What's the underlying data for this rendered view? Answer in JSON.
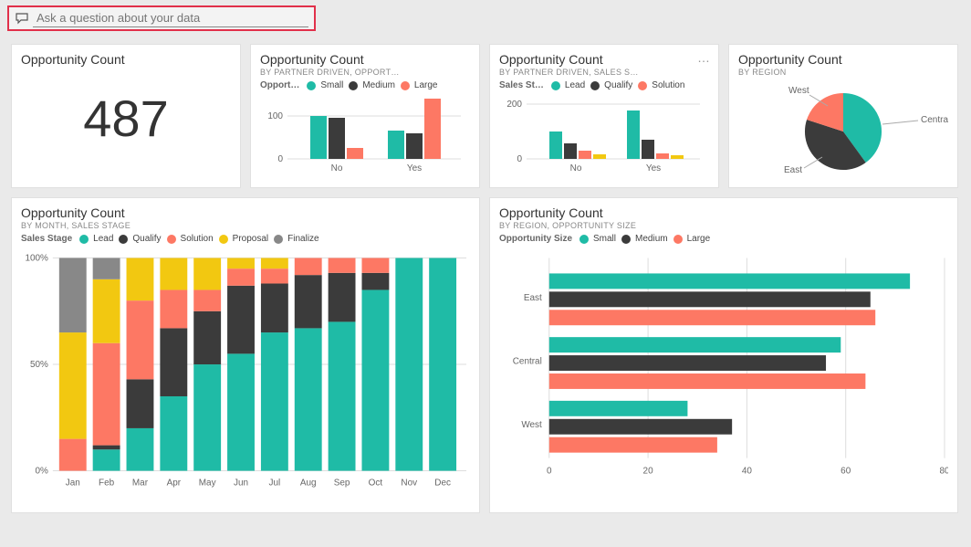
{
  "qna": {
    "placeholder": "Ask a question about your data"
  },
  "colors": {
    "teal": "#1fbba6",
    "dark": "#3b3b3b",
    "coral": "#fd7864",
    "yellow": "#f2c811",
    "gray": "#888888"
  },
  "card_kpi": {
    "title": "Opportunity Count",
    "value": "487"
  },
  "card_partner_size": {
    "title": "Opportunity Count",
    "subtitle": "BY PARTNER DRIVEN, OPPORT…",
    "legend_label": "Opport…",
    "legend": [
      "Small",
      "Medium",
      "Large"
    ]
  },
  "card_partner_stage": {
    "title": "Opportunity Count",
    "subtitle": "BY PARTNER DRIVEN, SALES S…",
    "legend_label": "Sales St…",
    "legend": [
      "Lead",
      "Qualify",
      "Solution"
    ]
  },
  "card_region_pie": {
    "title": "Opportunity Count",
    "subtitle": "BY REGION",
    "labels": {
      "west": "West",
      "east": "East",
      "central": "Central"
    }
  },
  "card_month_stage": {
    "title": "Opportunity Count",
    "subtitle": "BY MONTH, SALES STAGE",
    "legend_label": "Sales Stage",
    "legend": [
      "Lead",
      "Qualify",
      "Solution",
      "Proposal",
      "Finalize"
    ],
    "y_ticks": [
      "0%",
      "50%",
      "100%"
    ]
  },
  "card_region_size": {
    "title": "Opportunity Count",
    "subtitle": "BY REGION, OPPORTUNITY SIZE",
    "legend_label": "Opportunity Size",
    "legend": [
      "Small",
      "Medium",
      "Large"
    ],
    "regions": [
      "East",
      "Central",
      "West"
    ],
    "x_ticks": [
      "0",
      "20",
      "40",
      "60",
      "80"
    ]
  },
  "chart_data": [
    {
      "id": "kpi",
      "type": "table",
      "title": "Opportunity Count",
      "values": [
        487
      ]
    },
    {
      "id": "partner_driven_by_size",
      "type": "bar",
      "title": "Opportunity Count by Partner Driven, Opportunity Size",
      "categories": [
        "No",
        "Yes"
      ],
      "series": [
        {
          "name": "Small",
          "values": [
            100,
            65
          ]
        },
        {
          "name": "Medium",
          "values": [
            95,
            60
          ]
        },
        {
          "name": "Large",
          "values": [
            25,
            140
          ]
        }
      ],
      "ylim": [
        0,
        150
      ],
      "y_ticks": [
        0,
        100
      ]
    },
    {
      "id": "partner_driven_by_stage",
      "type": "bar",
      "title": "Opportunity Count by Partner Driven, Sales Stage",
      "categories": [
        "No",
        "Yes"
      ],
      "series": [
        {
          "name": "Lead",
          "values": [
            100,
            175
          ]
        },
        {
          "name": "Qualify",
          "values": [
            55,
            70
          ]
        },
        {
          "name": "Solution",
          "values": [
            30,
            20
          ]
        }
      ],
      "ylim": [
        0,
        200
      ],
      "y_ticks": [
        0,
        200
      ]
    },
    {
      "id": "region_pie",
      "type": "pie",
      "title": "Opportunity Count by Region",
      "categories": [
        "Central",
        "East",
        "West"
      ],
      "values": [
        40,
        40,
        20
      ]
    },
    {
      "id": "month_stage_stacked",
      "type": "bar",
      "title": "Opportunity Count by Month, Sales Stage (% stacked)",
      "categories": [
        "Jan",
        "Feb",
        "Mar",
        "Apr",
        "May",
        "Jun",
        "Jul",
        "Aug",
        "Sep",
        "Oct",
        "Nov",
        "Dec"
      ],
      "series": [
        {
          "name": "Lead",
          "values": [
            0,
            10,
            20,
            35,
            50,
            55,
            65,
            67,
            70,
            85,
            100,
            100
          ]
        },
        {
          "name": "Qualify",
          "values": [
            0,
            2,
            23,
            32,
            25,
            32,
            23,
            25,
            23,
            8,
            0,
            0
          ]
        },
        {
          "name": "Solution",
          "values": [
            15,
            48,
            37,
            18,
            10,
            8,
            7,
            8,
            7,
            7,
            0,
            0
          ]
        },
        {
          "name": "Proposal",
          "values": [
            50,
            30,
            20,
            15,
            15,
            5,
            5,
            0,
            0,
            0,
            0,
            0
          ]
        },
        {
          "name": "Finalize",
          "values": [
            35,
            10,
            0,
            0,
            0,
            0,
            0,
            0,
            0,
            0,
            0,
            0
          ]
        }
      ],
      "ylim": [
        0,
        100
      ]
    },
    {
      "id": "region_size_hbar",
      "type": "bar",
      "title": "Opportunity Count by Region, Opportunity Size",
      "categories": [
        "East",
        "Central",
        "West"
      ],
      "series": [
        {
          "name": "Small",
          "values": [
            73,
            59,
            28
          ]
        },
        {
          "name": "Medium",
          "values": [
            65,
            56,
            37
          ]
        },
        {
          "name": "Large",
          "values": [
            66,
            64,
            34
          ]
        }
      ],
      "xlim": [
        0,
        80
      ]
    }
  ]
}
